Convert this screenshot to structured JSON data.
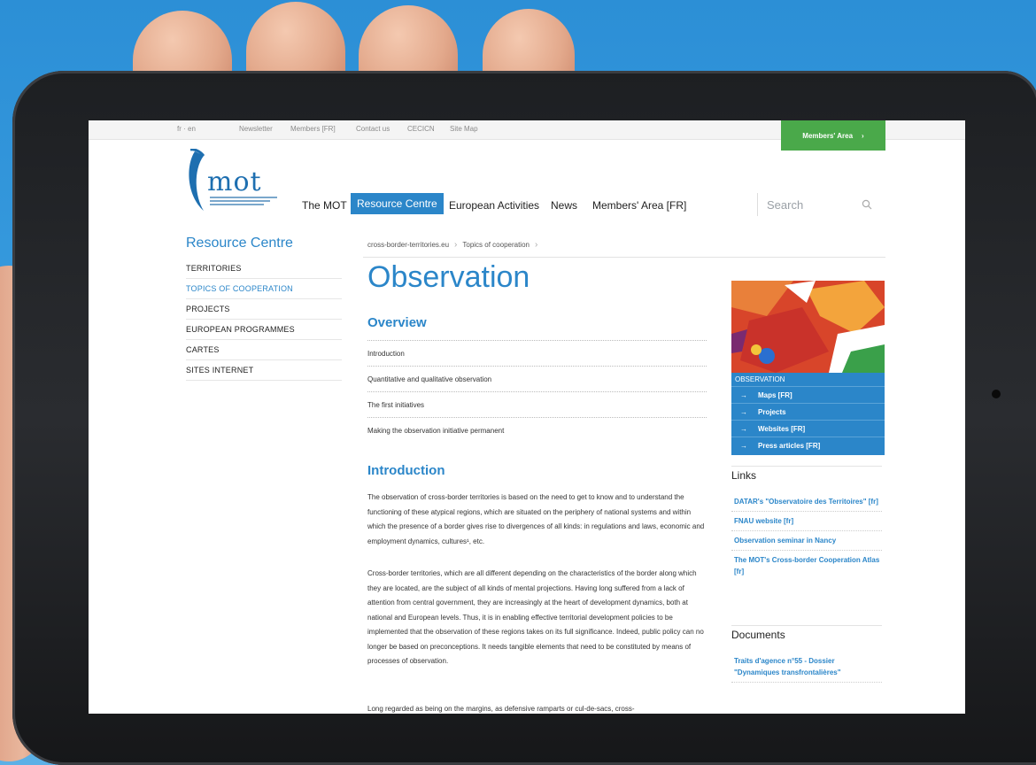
{
  "topbar": {
    "lang": "fr · en",
    "links": [
      "Newsletter",
      "Members [FR]",
      "Contact us",
      "CECICN",
      "Site Map"
    ],
    "members_area": "Members' Area"
  },
  "header": {
    "logo": "mot",
    "nav": [
      "The MOT",
      "Resource Centre",
      "European Activities",
      "News",
      "Members' Area [FR]"
    ],
    "active_nav": "Resource Centre",
    "search_placeholder": "Search"
  },
  "sidebar": {
    "title": "Resource Centre",
    "items": [
      "TERRITORIES",
      "TOPICS OF COOPERATION",
      "PROJECTS",
      "EUROPEAN PROGRAMMES",
      "CARTES",
      "SITES INTERNET"
    ],
    "active": "TOPICS OF COOPERATION"
  },
  "breadcrumb": [
    "cross-border-territories.eu",
    "Topics of cooperation"
  ],
  "main": {
    "title": "Observation",
    "overview_heading": "Overview",
    "overview_items": [
      "Introduction",
      "Quantitative and qualitative observation",
      "The first initiatives",
      "Making the observation initiative permanent"
    ],
    "intro_heading": "Introduction",
    "paragraph_1": "The observation of cross-border territories is based on the need to get to know and to understand the functioning of these atypical regions, which are situated on the periphery of national systems and within which the presence of a border gives rise to divergences of all kinds: in regulations and laws, economic and employment dynamics, cultures¹, etc.",
    "paragraph_2": "Cross-border territories, which are all different depending on the characteristics of the border along which they are located, are the subject of all kinds of mental projections. Having long suffered from a lack of attention from central government, they are increasingly at the heart of development dynamics, both at national and European levels. Thus, it is in enabling effective territorial development policies to be implemented that the observation of these regions takes on its full significance. Indeed, public policy can no longer be based on preconceptions. It needs tangible elements that need to be constituted by means of processes of observation.",
    "paragraph_3": "Long regarded as being on the margins, as defensive ramparts or cul-de-sacs, cross-"
  },
  "right": {
    "box_title": "OBSERVATION",
    "box_items": [
      "Maps [FR]",
      "Projects",
      "Websites [FR]",
      "Press articles [FR]"
    ],
    "links_heading": "Links",
    "links": [
      "DATAR's \"Observatoire des Territoires\" [fr]",
      "FNAU website [fr]",
      "Observation seminar in Nancy",
      "The MOT's Cross-border Cooperation Atlas [fr]"
    ],
    "documents_heading": "Documents",
    "documents": [
      "Traits d'agence n°55 - Dossier \"Dynamiques transfrontalières\""
    ]
  },
  "colors": {
    "accent_blue": "#2b86c9",
    "members_green": "#4aa94a",
    "background_blue": "#2c8fd6",
    "tablet_bezel": "#1d1f22"
  }
}
